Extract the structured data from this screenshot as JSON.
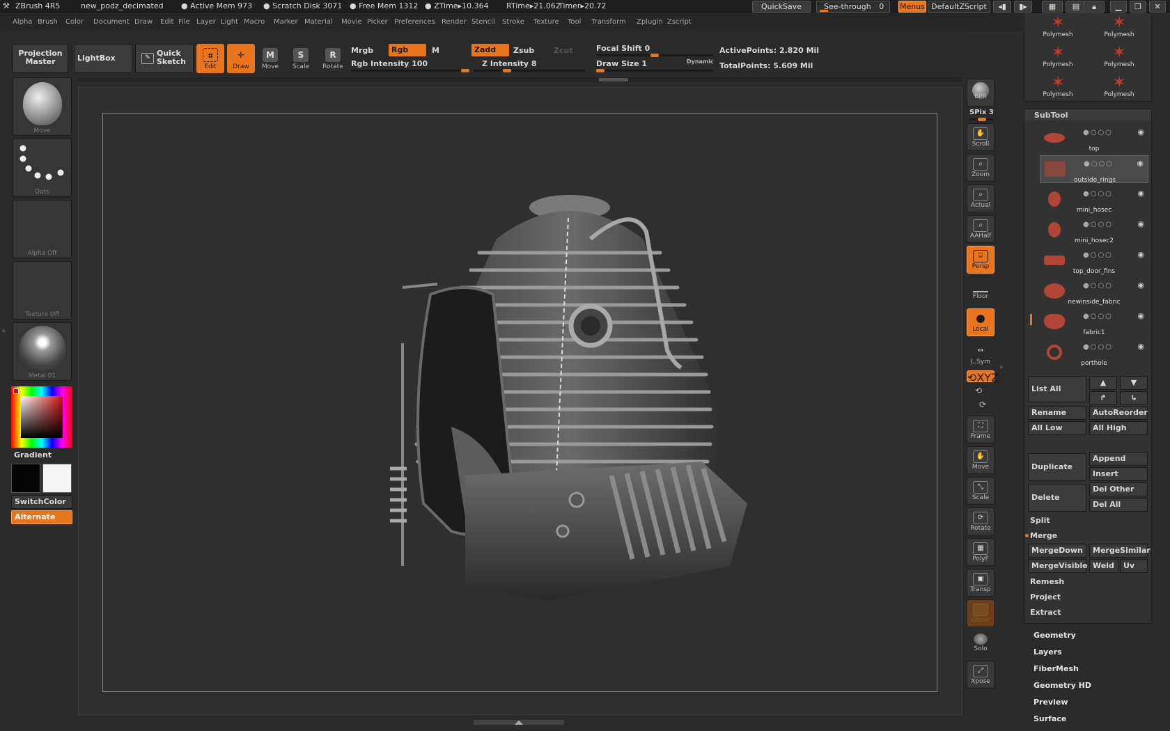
{
  "titlebar": {
    "app": "ZBrush 4R5",
    "document": "new_podz_decimated",
    "active_mem": "● Active Mem 973",
    "scratch_disk": "● Scratch Disk 3071",
    "free_mem": "● Free Mem 1312",
    "ztime": "● ZTime▸10.364",
    "rtime": "RTime▸21.062",
    "timer": "Timer▸20.72",
    "quicksave": "QuickSave",
    "see_through_label": "See-through",
    "see_through_value": "0",
    "menus": "Menus",
    "default_zscript": "DefaultZScript"
  },
  "menubar": [
    "Alpha",
    "Brush",
    "Color",
    "Document",
    "Draw",
    "Edit",
    "File",
    "Layer",
    "Light",
    "Macro",
    "Marker",
    "Material",
    "Movie",
    "Picker",
    "Preferences",
    "Render",
    "Stencil",
    "Stroke",
    "Texture",
    "Tool",
    "Transform",
    "Zplugin",
    "Zscript"
  ],
  "shelf": {
    "projection_master": "Projection Master",
    "lightbox": "LightBox",
    "quick_sketch": "Quick Sketch",
    "edit": "Edit",
    "draw": "Draw",
    "move": "Move",
    "scale": "Scale",
    "rotate": "Rotate",
    "mrgb": "Mrgb",
    "rgb": "Rgb",
    "m": "M",
    "zadd": "Zadd",
    "zsub": "Zsub",
    "zcut": "Zcut",
    "rgb_intensity": "Rgb Intensity 100",
    "rgb_intensity_value": 100,
    "z_intensity": "Z Intensity 8",
    "z_intensity_value": 8,
    "focal_shift": "Focal Shift 0",
    "focal_shift_value": 0,
    "draw_size": "Draw Size 1",
    "draw_size_value": 1,
    "dynamic": "Dynamic",
    "active_points": "ActivePoints: 2.820 Mil",
    "total_points": "TotalPoints: 5.609 Mil"
  },
  "left_tray": {
    "move": "Move",
    "dots": "Dots",
    "alpha": "Alpha Off",
    "texture": "Texture Off",
    "material": "Metal 01",
    "gradient": "Gradient",
    "switch_color": "SwitchColor",
    "alternate": "Alternate"
  },
  "right_toolbar": {
    "bpr": "BPR",
    "spix": "SPix 3",
    "scroll": "Scroll",
    "zoom": "Zoom",
    "actual": "Actual",
    "aahalf": "AAHalf",
    "persp": "Persp",
    "floor": "Floor",
    "local": "Local",
    "lsym": "L.Sym",
    "xyz": "⟲XYZ",
    "frame": "Frame",
    "move": "Move",
    "scale": "Scale",
    "rotate": "Rotate",
    "polyf": "PolyF",
    "transp": "Transp",
    "ghost": "Ghost",
    "solo": "Solo",
    "xpose": "Xpose"
  },
  "tool_palette": {
    "polymesh": [
      "Polymesh",
      "Polymesh",
      "Polymesh",
      "Polymesh",
      "Polymesh",
      "Polymesh"
    ]
  },
  "subtool": {
    "title": "SubTool",
    "items": [
      "top",
      "outside_rings",
      "mini_hosec",
      "mini_hosec2",
      "top_door_fins",
      "newinside_fabric",
      "fabric1",
      "porthole"
    ],
    "list_all": "List All",
    "rename": "Rename",
    "auto_reorder": "AutoReorder",
    "all_low": "All Low",
    "all_high": "All High",
    "duplicate": "Duplicate",
    "append": "Append",
    "insert": "Insert",
    "delete": "Delete",
    "del_other": "Del Other",
    "del_all": "Del All",
    "split": "Split",
    "merge": "Merge",
    "merge_down": "MergeDown",
    "merge_similar": "MergeSimilar",
    "merge_visible": "MergeVisible",
    "weld": "Weld",
    "uv": "Uv",
    "remesh": "Remesh",
    "project": "Project",
    "extract": "Extract"
  },
  "sections": [
    "Geometry",
    "Layers",
    "FiberMesh",
    "Geometry HD",
    "Preview",
    "Surface"
  ],
  "colors": {
    "accent": "#e8741c",
    "panel": "#2b2b2b",
    "subtool_thumb": "#b24636"
  }
}
